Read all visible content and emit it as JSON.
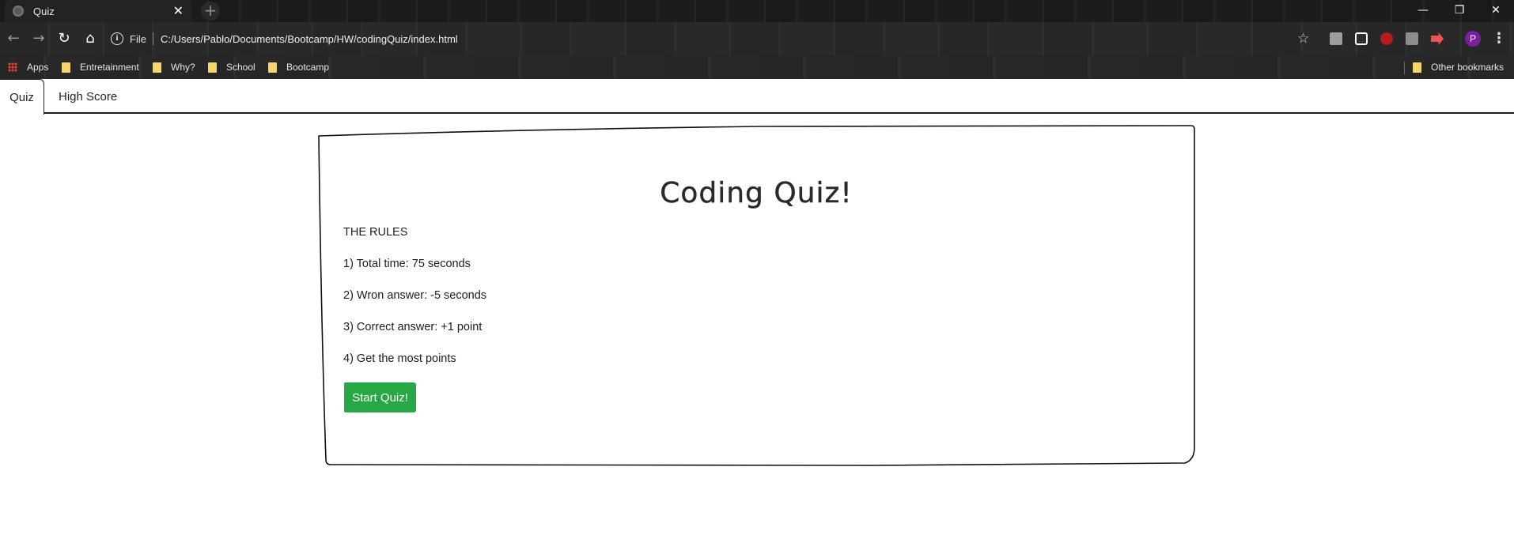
{
  "browser": {
    "tab_title": "Quiz",
    "tab_close": "✕",
    "new_tab": "+",
    "window_controls": {
      "minimize": "—",
      "restore": "❐",
      "close": "✕"
    },
    "nav": {
      "back": "←",
      "forward": "→",
      "reload": "↻",
      "home": "⌂"
    },
    "info_icon": "i",
    "file_label": "File",
    "url": "C:/Users/Pablo/Documents/Bootcamp/HW/codingQuiz/index.html",
    "star_icon": "☆",
    "profile_initial": "P",
    "menu_icon": "⋮",
    "extension_colors": [
      "#9e9e9e",
      "#ffffff",
      "#b71c1c",
      "#8d8d8d",
      "#ef5350"
    ],
    "bookmarks": [
      {
        "label": "Apps",
        "icon": "apps-grid-icon"
      },
      {
        "label": "Entretainment",
        "icon": "folder-icon"
      },
      {
        "label": "Why?",
        "icon": "folder-icon"
      },
      {
        "label": "School",
        "icon": "folder-icon"
      },
      {
        "label": "Bootcamp",
        "icon": "folder-icon"
      }
    ],
    "other_bookmarks": "Other bookmarks"
  },
  "nav": {
    "quiz": "Quiz",
    "high_score": "High Score"
  },
  "quiz": {
    "title": "Coding Quiz!",
    "rules_heading": "THE RULES",
    "rules": [
      "1) Total time: 75 seconds",
      "2) Wron answer: -5 seconds",
      "3) Correct answer: +1 point",
      "4) Get the most points"
    ],
    "start_label": "Start Quiz!",
    "button_color": "#28a745"
  }
}
